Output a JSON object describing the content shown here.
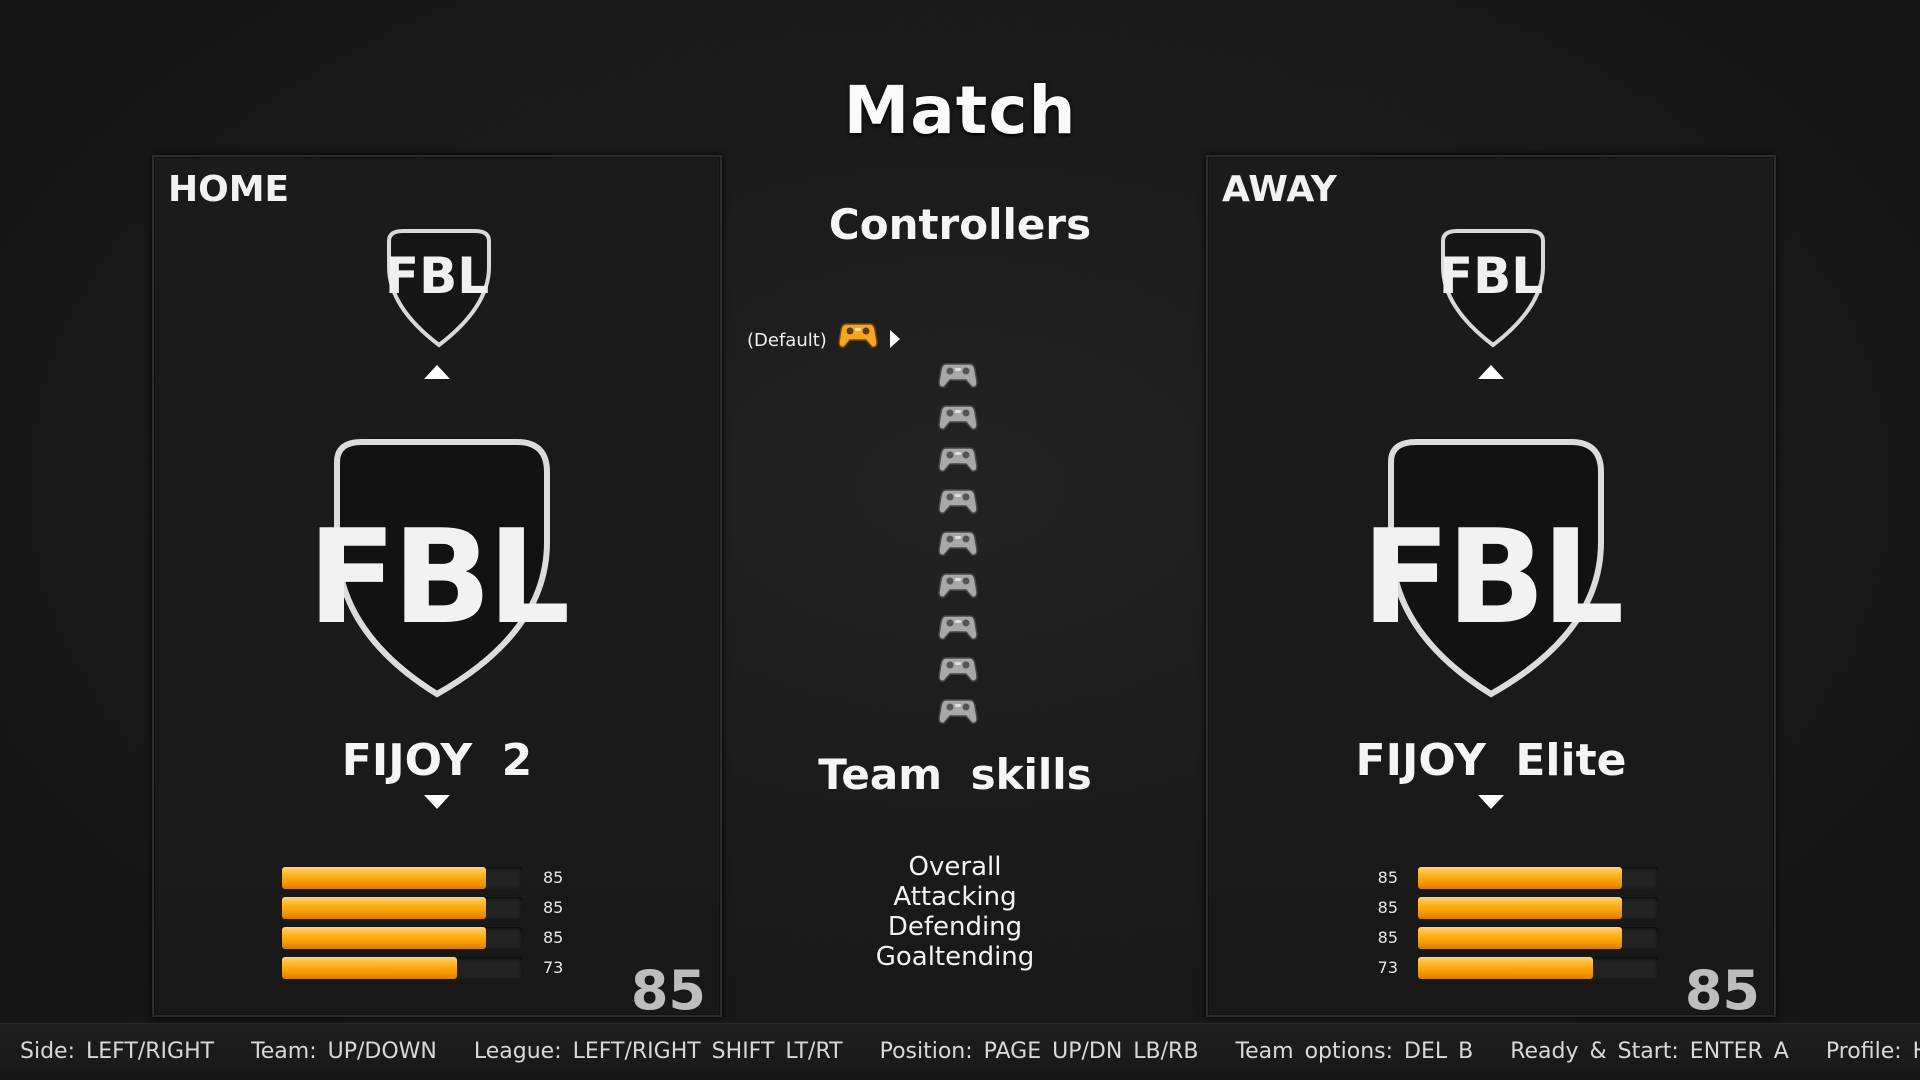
{
  "title": "Match",
  "home": {
    "side_label": "HOME",
    "league_logo": "fbl-shield-icon",
    "league_logo_text": "FBL",
    "team_logo_text": "FBL",
    "team_name": "FIJOY 2",
    "skills": [
      {
        "name": "Overall",
        "value": 85
      },
      {
        "name": "Attacking",
        "value": 85
      },
      {
        "name": "Defending",
        "value": 85
      },
      {
        "name": "Goaltending",
        "value": 73
      }
    ],
    "overall": "85"
  },
  "away": {
    "side_label": "AWAY",
    "league_logo": "fbl-shield-icon",
    "league_logo_text": "FBL",
    "team_logo_text": "FBL",
    "team_name": "FIJOY Elite",
    "skills": [
      {
        "name": "Overall",
        "value": 85
      },
      {
        "name": "Attacking",
        "value": 85
      },
      {
        "name": "Defending",
        "value": 85
      },
      {
        "name": "Goaltending",
        "value": 73
      }
    ],
    "overall": "85"
  },
  "controllers": {
    "title": "Controllers",
    "default_label": "(Default)",
    "active_icon": "gamepad-orange-icon",
    "inactive_icon": "gamepad-gray-icon",
    "inactive_count": 9
  },
  "team_skills": {
    "title": "Team skills",
    "labels": [
      "Overall",
      "Attacking",
      "Defending",
      "Goaltending"
    ]
  },
  "footer": {
    "hints": [
      "Side: LEFT/RIGHT",
      "Team: UP/DOWN",
      "League: LEFT/RIGHT SHIFT LT/RT",
      "Position: PAGE UP/DN LB/RB",
      "Team options: DEL B",
      "Ready & Start: ENTER A",
      "Profile: HOME X"
    ]
  },
  "colors": {
    "bar_fill": "#ffb41e",
    "active_controller": "#f5a623",
    "inactive_controller": "#a8a8a8",
    "background": "#1a1a1a"
  }
}
